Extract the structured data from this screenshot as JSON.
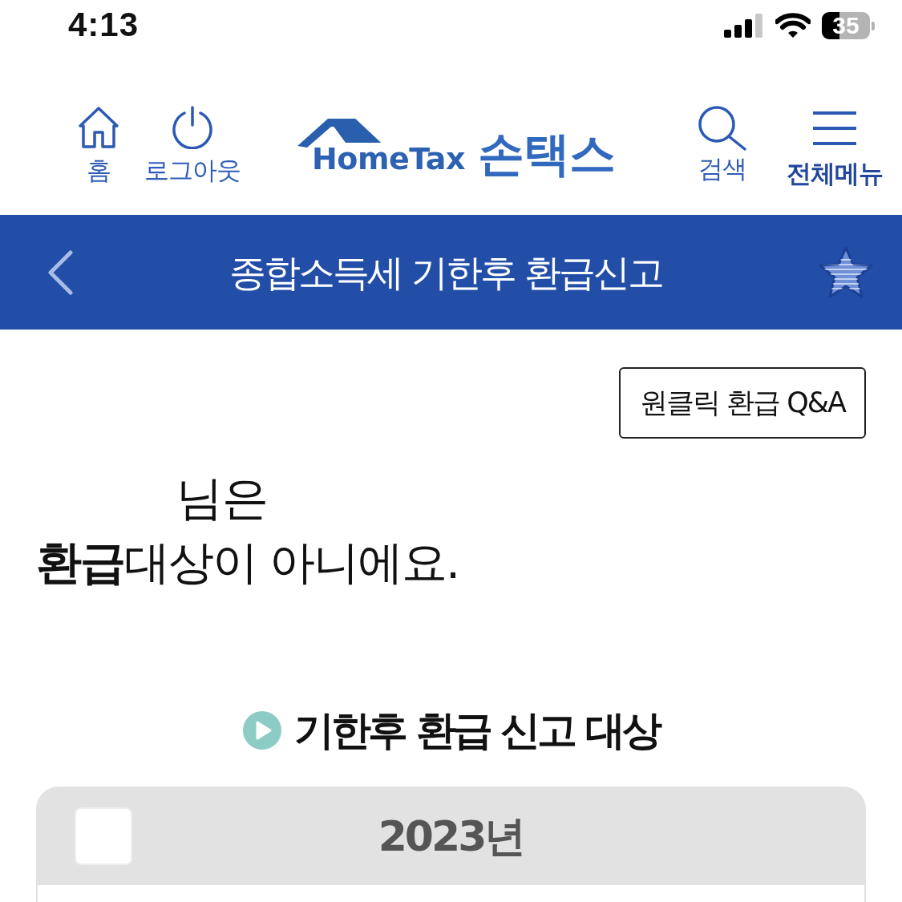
{
  "status_bar": {
    "time": "4:13",
    "battery": "35"
  },
  "header": {
    "nav_left": [
      {
        "kind": "home",
        "label": "홈"
      },
      {
        "kind": "logout",
        "label": "로그아웃"
      }
    ],
    "logo": {
      "wordmark": "HomeTax",
      "name": "손택스"
    },
    "nav_right": [
      {
        "kind": "search",
        "label": "검색"
      },
      {
        "kind": "menu",
        "label": "전체메뉴"
      }
    ]
  },
  "title_bar": {
    "title": "종합소득세 기한후 환급신고"
  },
  "qa_button": {
    "label": "원클릭 환급 Q&A"
  },
  "result": {
    "greeting": "님은",
    "message": "**환급**대상이 아니에요."
  },
  "section": {
    "heading": "기한후 환급 신고 대상",
    "years": [
      {
        "label": "2023년",
        "checked": false
      }
    ]
  }
}
